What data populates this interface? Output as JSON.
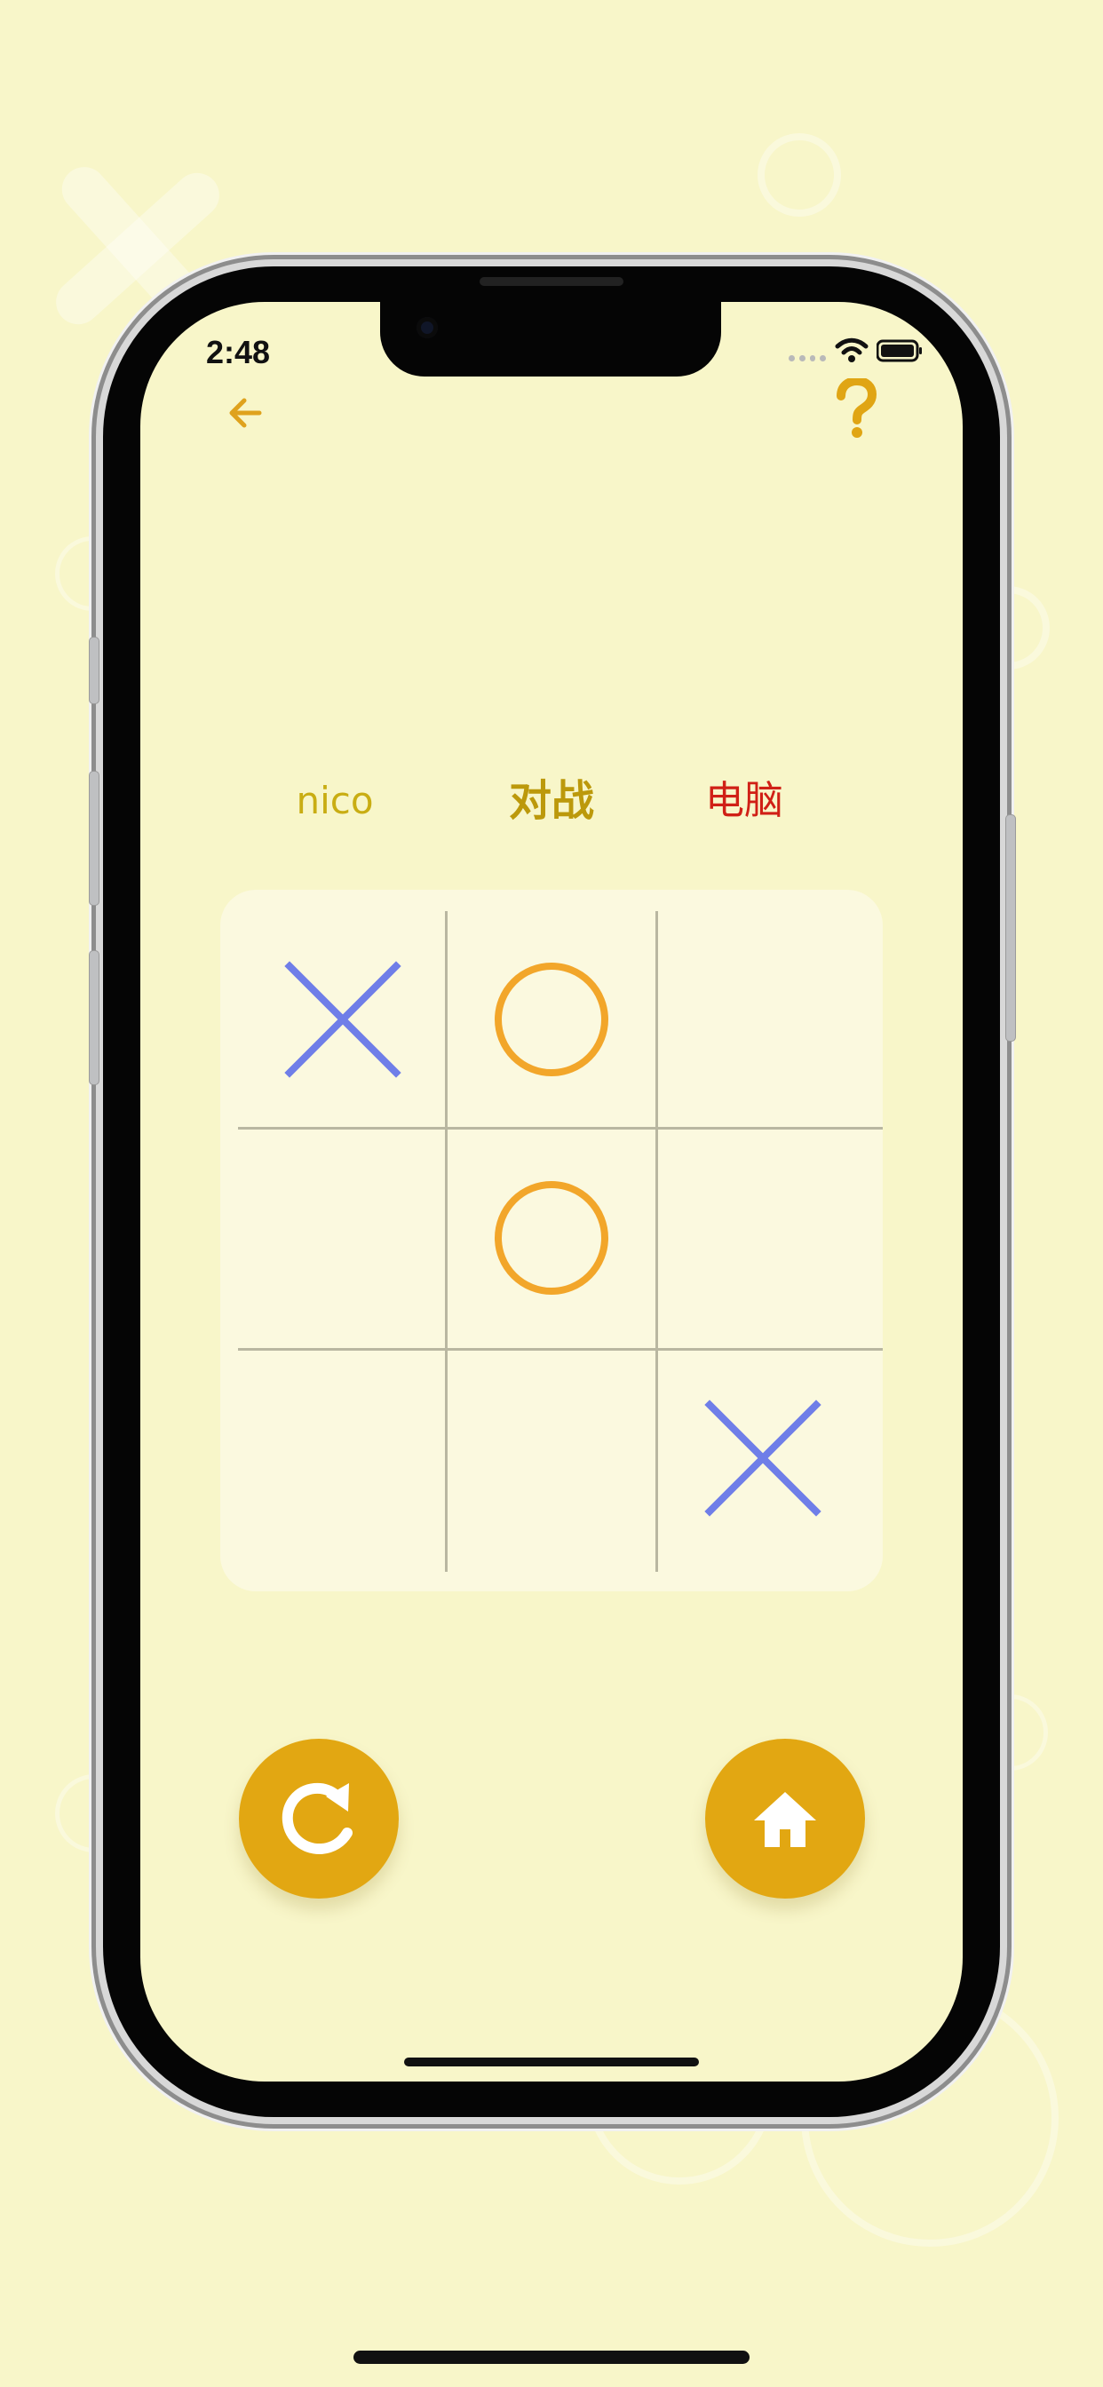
{
  "status_bar": {
    "time": "2:48"
  },
  "navigation": {
    "back_icon": "arrow-left-icon",
    "help_icon": "question-mark-icon"
  },
  "match": {
    "player_name": "nico",
    "versus_label": "对战",
    "opponent_name": "电脑"
  },
  "board": {
    "cells": [
      {
        "row": 1,
        "column": 1,
        "mark": "X"
      },
      {
        "row": 1,
        "column": 2,
        "mark": "O"
      },
      {
        "row": 1,
        "column": 3,
        "mark": ""
      },
      {
        "row": 2,
        "column": 1,
        "mark": ""
      },
      {
        "row": 2,
        "column": 2,
        "mark": "O"
      },
      {
        "row": 2,
        "column": 3,
        "mark": ""
      },
      {
        "row": 3,
        "column": 1,
        "mark": ""
      },
      {
        "row": 3,
        "column": 2,
        "mark": ""
      },
      {
        "row": 3,
        "column": 3,
        "mark": "X"
      }
    ]
  },
  "actions": {
    "restart_icon": "restart-icon",
    "home_icon": "home-icon"
  },
  "colors": {
    "background": "#f8f6c9",
    "accent": "#e2a712",
    "x_mark": "#6f7ee8",
    "o_mark": "#f2a62a",
    "player_name": "#c9ad13",
    "versus_label": "#bc990b",
    "opponent_name": "#d02016"
  }
}
